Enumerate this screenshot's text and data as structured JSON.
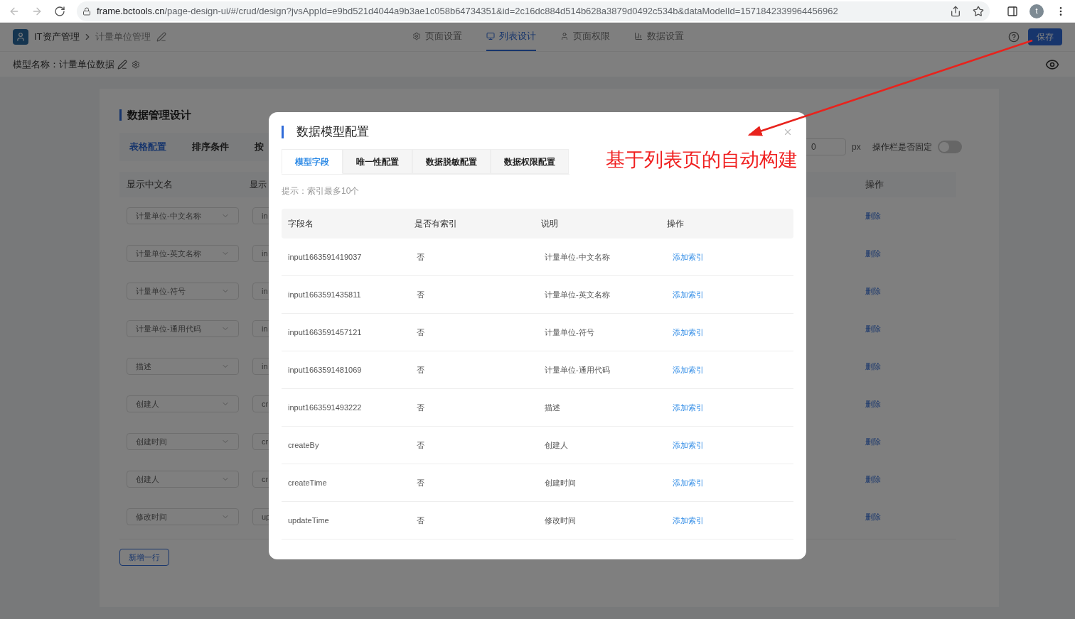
{
  "browser": {
    "url_domain": "frame.bctools.cn",
    "url_path": "/page-design-ui/#/crud/design?jvsAppId=e9bd521d4044a9b3ae1c058b64734351&id=2c16dc884d514b628a3879d0492c534b&dataModelId=1571842339964456962",
    "avatar": "t"
  },
  "header": {
    "app": "IT资产管理",
    "page": "计量单位管理",
    "nav": [
      {
        "label": "页面设置",
        "selected": false
      },
      {
        "label": "列表设计",
        "selected": true
      },
      {
        "label": "页面权限",
        "selected": false
      },
      {
        "label": "数据设置",
        "selected": false
      }
    ],
    "save": "保存"
  },
  "model_bar": {
    "label": "模型名称：计量单位数据"
  },
  "design": {
    "title": "数据管理设计",
    "tabs": [
      {
        "label": "表格配置",
        "selected": true
      },
      {
        "label": "排序条件",
        "selected": false
      },
      {
        "label": "按",
        "selected": false
      }
    ],
    "width_value": "0",
    "width_unit": "px",
    "fixed_label": "操作栏是否固定",
    "fixed_on": false,
    "columns": [
      "显示中文名",
      "显示"
    ],
    "action_header": "操作",
    "rows": [
      {
        "name": "计量单位-中文名称",
        "field": "in",
        "action": "删除"
      },
      {
        "name": "计量单位-英文名称",
        "field": "in",
        "action": "删除"
      },
      {
        "name": "计量单位-符号",
        "field": "in",
        "action": "删除"
      },
      {
        "name": "计量单位-通用代码",
        "field": "in",
        "action": "删除"
      },
      {
        "name": "描述",
        "field": "in",
        "action": "删除"
      },
      {
        "name": "创建人",
        "field": "cr",
        "action": "删除"
      },
      {
        "name": "创建时间",
        "field": "cr",
        "action": "删除"
      },
      {
        "name": "创建人",
        "field": "cr",
        "action": "删除"
      },
      {
        "name": "修改时间",
        "field": "up",
        "action": "删除"
      }
    ],
    "add_button": "新增一行"
  },
  "modal": {
    "title": "数据模型配置",
    "tabs": [
      {
        "label": "模型字段",
        "selected": true
      },
      {
        "label": "唯一性配置",
        "selected": false
      },
      {
        "label": "数据脱敏配置",
        "selected": false
      },
      {
        "label": "数据权限配置",
        "selected": false
      }
    ],
    "hint": "提示：索引最多10个",
    "columns": [
      "字段名",
      "是否有索引",
      "说明",
      "操作"
    ],
    "rows": [
      {
        "field": "input1663591419037",
        "indexed": "否",
        "description": "计量单位-中文名称",
        "action": "添加索引"
      },
      {
        "field": "input1663591435811",
        "indexed": "否",
        "description": "计量单位-英文名称",
        "action": "添加索引"
      },
      {
        "field": "input1663591457121",
        "indexed": "否",
        "description": "计量单位-符号",
        "action": "添加索引"
      },
      {
        "field": "input1663591481069",
        "indexed": "否",
        "description": "计量单位-通用代码",
        "action": "添加索引"
      },
      {
        "field": "input1663591493222",
        "indexed": "否",
        "description": "描述",
        "action": "添加索引"
      },
      {
        "field": "createBy",
        "indexed": "否",
        "description": "创建人",
        "action": "添加索引"
      },
      {
        "field": "createTime",
        "indexed": "否",
        "description": "创建时间",
        "action": "添加索引"
      },
      {
        "field": "updateTime",
        "indexed": "否",
        "description": "修改时间",
        "action": "添加索引"
      }
    ]
  },
  "annotation": {
    "text": "基于列表页的自动构建"
  }
}
